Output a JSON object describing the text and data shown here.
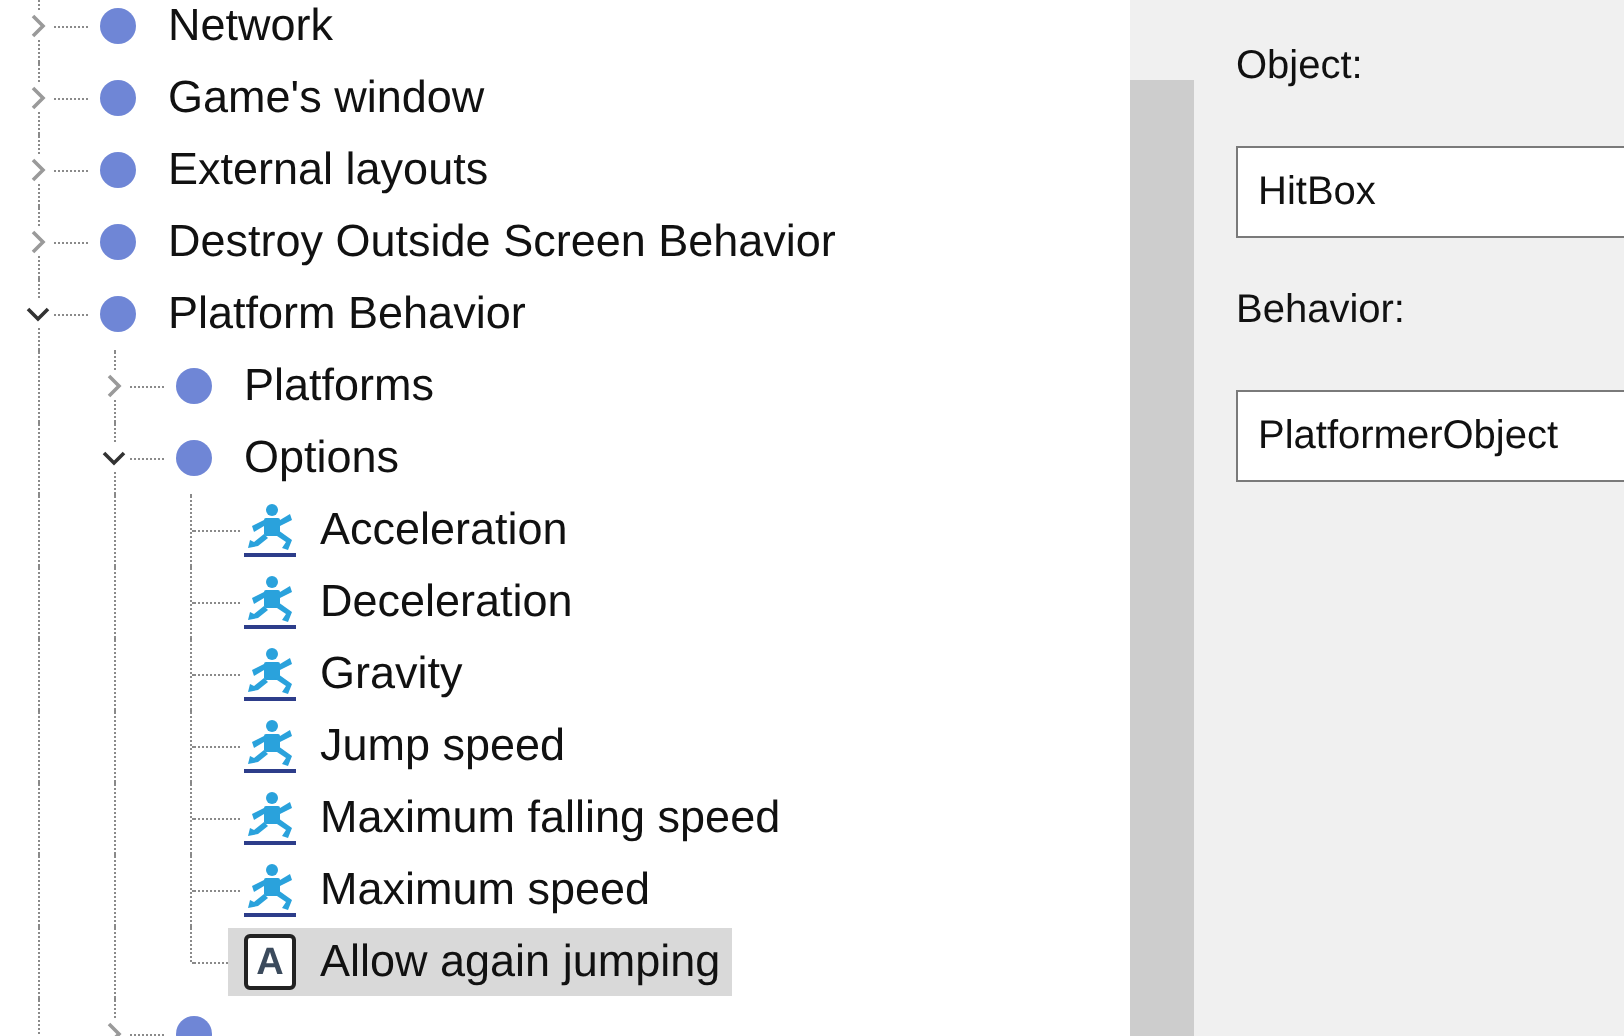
{
  "tree": [
    {
      "label": "Network",
      "kind": "category",
      "expanded": false,
      "selected": false
    },
    {
      "label": "Game's window",
      "kind": "category",
      "expanded": false,
      "selected": false
    },
    {
      "label": "External layouts",
      "kind": "category",
      "expanded": false,
      "selected": false
    },
    {
      "label": "Destroy Outside Screen Behavior",
      "kind": "category",
      "expanded": false,
      "selected": false
    },
    {
      "label": "Platform Behavior",
      "kind": "category",
      "expanded": true,
      "selected": false,
      "children": [
        {
          "label": "Platforms",
          "kind": "category",
          "expanded": false,
          "selected": false
        },
        {
          "label": "Options",
          "kind": "category",
          "expanded": true,
          "selected": false,
          "children": [
            {
              "label": "Acceleration",
              "kind": "action",
              "selected": false
            },
            {
              "label": "Deceleration",
              "kind": "action",
              "selected": false
            },
            {
              "label": "Gravity",
              "kind": "action",
              "selected": false
            },
            {
              "label": "Jump speed",
              "kind": "action",
              "selected": false
            },
            {
              "label": "Maximum falling speed",
              "kind": "action",
              "selected": false
            },
            {
              "label": "Maximum speed",
              "kind": "action",
              "selected": false
            },
            {
              "label": "Allow again jumping",
              "kind": "letter",
              "icon_letter": "A",
              "selected": true
            }
          ]
        },
        {
          "kind": "category",
          "expanded": false,
          "selected": false
        }
      ]
    }
  ],
  "panel": {
    "fields": [
      {
        "label": "Object:",
        "value": "HitBox"
      },
      {
        "label": "Behavior:",
        "value": "PlatformerObject"
      }
    ]
  }
}
